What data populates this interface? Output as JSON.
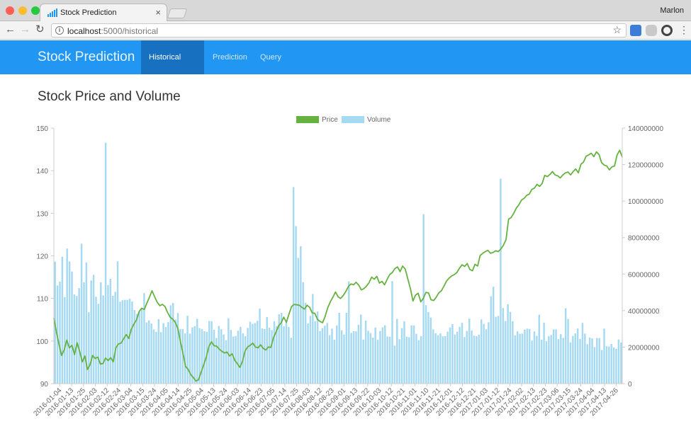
{
  "window": {
    "tab_title": "Stock Prediction",
    "user": "Marlon",
    "url_host": "localhost",
    "url_path": ":5000/historical",
    "colors": {
      "close": "#ff5f57",
      "minimize": "#febc2e",
      "zoom": "#28c840"
    }
  },
  "app": {
    "brand": "Stock Prediction",
    "nav": [
      {
        "label": "Historical Data",
        "active": true
      },
      {
        "label": "Prediction",
        "active": false
      },
      {
        "label": "Query",
        "active": false
      }
    ],
    "primary_color": "#2196f3",
    "active_color": "#1870c0"
  },
  "page": {
    "title": "Stock Price and Volume"
  },
  "chart_data": {
    "type": "bar+line",
    "title": "",
    "legend": [
      {
        "name": "Price",
        "color": "#66b240"
      },
      {
        "name": "Volume",
        "color": "#a6d9f2"
      }
    ],
    "legend_position": "top-center",
    "y_left": {
      "ylim": [
        90,
        150
      ],
      "ticks": [
        "90",
        "100",
        "110",
        "120",
        "130",
        "140",
        "150"
      ]
    },
    "y_right": {
      "ylim": [
        0,
        140000000
      ],
      "ticks": [
        "0",
        "20000000",
        "40000000",
        "60000000",
        "80000000",
        "100000000",
        "120000000",
        "140000000"
      ]
    },
    "x_tick_labels": [
      "2016-01-04",
      "2016-01-13",
      "2016-01-25",
      "2016-02-03",
      "2016-02-12",
      "2016-02-24",
      "2016-03-04",
      "2016-03-15",
      "2016-03-24",
      "2016-04-05",
      "2016-04-14",
      "2016-04-25",
      "2016-05-04",
      "2016-05-13",
      "2016-05-24",
      "2016-06-03",
      "2016-06-14",
      "2016-06-23",
      "2016-07-05",
      "2016-07-14",
      "2016-07-25",
      "2016-08-03",
      "2016-08-12",
      "2016-08-23",
      "2016-09-01",
      "2016-09-13",
      "2016-09-22",
      "2016-10-03",
      "2016-10-12",
      "2016-10-21",
      "2016-11-01",
      "2016-11-10",
      "2016-11-21",
      "2016-12-01",
      "2016-12-12",
      "2016-12-21",
      "2017-01-03",
      "2017-01-12",
      "2017-01-24",
      "2017-02-02",
      "2017-02-13",
      "2017-02-23",
      "2017-03-06",
      "2017-03-15",
      "2017-03-24",
      "2017-04-04",
      "2017-04-13",
      "2017-04-26"
    ],
    "series": [
      {
        "name": "Price",
        "axis": "left",
        "type": "line",
        "values": [
          105.4,
          102.1,
          99.2,
          96.6,
          97.9,
          100.2,
          98.4,
          99.0,
          96.8,
          99.6,
          97.5,
          95.1,
          96.5,
          93.3,
          94.4,
          96.6,
          95.9,
          96.2,
          94.6,
          94.7,
          96.0,
          95.4,
          96.1,
          95.1,
          98.4,
          99.3,
          99.5,
          100.5,
          101.5,
          100.6,
          102.8,
          104.0,
          105.0,
          106.9,
          107.7,
          107.4,
          108.9,
          110.3,
          111.8,
          110.4,
          109.1,
          108.3,
          108.6,
          108.1,
          106.7,
          105.6,
          105.1,
          104.4,
          102.9,
          99.8,
          97.0,
          94.0,
          93.3,
          92.1,
          91.4,
          90.6,
          90.9,
          92.7,
          94.4,
          96.2,
          98.7,
          99.8,
          98.9,
          98.8,
          98.1,
          97.6,
          97.2,
          97.4,
          96.5,
          97.0,
          95.5,
          94.7,
          93.8,
          95.2,
          97.7,
          98.6,
          99.0,
          99.5,
          98.6,
          98.4,
          99.1,
          98.3,
          97.9,
          98.6,
          98.5,
          100.8,
          102.1,
          103.6,
          104.3,
          105.6,
          104.4,
          106.3,
          108.1,
          108.6,
          108.5,
          108.4,
          107.9,
          107.5,
          108.4,
          107.9,
          106.6,
          106.5,
          105.1,
          104.6,
          104.3,
          105.8,
          107.8,
          109.2,
          110.3,
          111.5,
          110.4,
          110.0,
          110.7,
          111.6,
          112.8,
          113.4,
          113.2,
          113.8,
          113.1,
          112.0,
          112.3,
          112.9,
          113.7,
          115.0,
          114.5,
          115.2,
          113.6,
          114.0,
          113.2,
          114.5,
          115.6,
          116.1,
          117.0,
          117.4,
          116.3,
          117.6,
          116.9,
          114.6,
          112.3,
          109.4,
          110.8,
          111.2,
          109.2,
          110.0,
          111.4,
          111.3,
          109.7,
          109.5,
          110.3,
          111.3,
          111.8,
          112.9,
          114.1,
          114.8,
          115.3,
          115.6,
          116.1,
          117.1,
          117.9,
          117.5,
          118.2,
          116.8,
          116.5,
          118.0,
          117.6,
          120.1,
          120.6,
          121.0,
          121.3,
          120.6,
          120.8,
          121.2,
          121.0,
          121.6,
          122.5,
          123.8,
          128.6,
          129.0,
          130.0,
          131.2,
          132.0,
          133.1,
          133.5,
          134.2,
          134.5,
          135.6,
          135.9,
          136.8,
          136.3,
          137.0,
          138.9,
          138.6,
          139.1,
          139.8,
          139.0,
          138.8,
          138.3,
          139.0,
          139.5,
          139.7,
          139.0,
          139.8,
          140.4,
          139.5,
          141.5,
          142.0,
          143.4,
          143.7,
          144.1,
          143.3,
          144.4,
          143.8,
          141.9,
          141.3,
          141.1,
          140.2,
          140.9,
          141.1,
          143.7,
          144.8,
          143.2
        ]
      },
      {
        "name": "Volume",
        "axis": "right",
        "type": "bar",
        "values": [
          66800000,
          53800000,
          55900000,
          69500000,
          47400000,
          74000000,
          66900000,
          61400000,
          48800000,
          48000000,
          52300000,
          76700000,
          55500000,
          66400000,
          39100000,
          56500000,
          59600000,
          47600000,
          43700000,
          55500000,
          48300000,
          132000000,
          54000000,
          57400000,
          48100000,
          50300000,
          67000000,
          44900000,
          45700000,
          45900000,
          45900000,
          46500000,
          45000000,
          40300000,
          38200000,
          39300000,
          40700000,
          49600000,
          33500000,
          34600000,
          32900000,
          29700000,
          28300000,
          35300000,
          28200000,
          33100000,
          31000000,
          33700000,
          42900000,
          44200000,
          35100000,
          38700000,
          29900000,
          29900000,
          27500000,
          37200000,
          27400000,
          30800000,
          31500000,
          35500000,
          30400000,
          29900000,
          28700000,
          28400000,
          34300000,
          34200000,
          29500000,
          25000000,
          31600000,
          29800000,
          26900000,
          23800000,
          35800000,
          29400000,
          25800000,
          26100000,
          29000000,
          31100000,
          27500000,
          26000000,
          30500000,
          33900000,
          32700000,
          33200000,
          34400000,
          41100000,
          30200000,
          29900000,
          36500000,
          30600000,
          29300000,
          34200000,
          31500000,
          38000000,
          38800000,
          31400000,
          33800000,
          31100000,
          25100000,
          107700000,
          86300000,
          68900000,
          75300000,
          55600000,
          44300000,
          33000000,
          37100000,
          49100000,
          34200000,
          39500000,
          28800000,
          30400000,
          31700000,
          33200000,
          26500000,
          30100000,
          24000000,
          31900000,
          38800000,
          29200000,
          26900000,
          38800000,
          56000000,
          27800000,
          28700000,
          28600000,
          32200000,
          37800000,
          24100000,
          34500000,
          28900000,
          27700000,
          25200000,
          30700000,
          24000000,
          28800000,
          30800000,
          32000000,
          25800000,
          25700000,
          56200000,
          20800000,
          35500000,
          24300000,
          30400000,
          34100000,
          25700000,
          25400000,
          31900000,
          31900000,
          27300000,
          23800000,
          26000000,
          92800000,
          43000000,
          39200000,
          36200000,
          29700000,
          27600000,
          26500000,
          27500000,
          25900000,
          26000000,
          28500000,
          30800000,
          32600000,
          26900000,
          28400000,
          31100000,
          33300000,
          25500000,
          28800000,
          35600000,
          29100000,
          26300000,
          26000000,
          26800000,
          35200000,
          32700000,
          29800000,
          33600000,
          47900000,
          53100000,
          36600000,
          37100000,
          112300000,
          41400000,
          34300000,
          43500000,
          39300000,
          34200000,
          26400000,
          28600000,
          27300000,
          27400000,
          29600000,
          30100000,
          29900000,
          23600000,
          28600000,
          26200000,
          37700000,
          24100000,
          33400000,
          23200000,
          26000000,
          26600000,
          29700000,
          29700000,
          24400000,
          27100000,
          25000000,
          41300000,
          35400000,
          22600000,
          26100000,
          27500000,
          30200000,
          24500000,
          33300000,
          27400000,
          21600000,
          25200000,
          24800000,
          20000000,
          25000000,
          24900000,
          18400000,
          30100000,
          20500000,
          20300000,
          21700000,
          19800000,
          19100000,
          24200000,
          22500000
        ]
      }
    ]
  }
}
